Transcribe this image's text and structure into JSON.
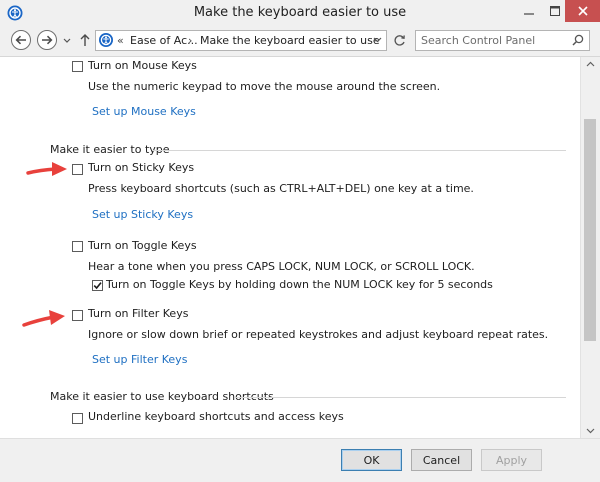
{
  "window": {
    "title": "Make the keyboard easier to use"
  },
  "nav": {
    "overflow": "«",
    "breadcrumb": [
      "Ease of Ac...",
      "Make the keyboard easier to use"
    ],
    "separator": "›",
    "search_placeholder": "Search Control Panel"
  },
  "mouse_keys": {
    "checkbox_label": "Turn on Mouse Keys",
    "description": "Use the numeric keypad to move the mouse around the screen.",
    "setup_link": "Set up Mouse Keys",
    "checked": false
  },
  "typing_group": {
    "header": "Make it easier to type",
    "sticky_keys": {
      "checkbox_label": "Turn on Sticky Keys",
      "description": "Press keyboard shortcuts (such as CTRL+ALT+DEL) one key at a time.",
      "setup_link": "Set up Sticky Keys",
      "checked": false
    },
    "toggle_keys": {
      "checkbox_label": "Turn on Toggle Keys",
      "description": "Hear a tone when you press CAPS LOCK, NUM LOCK, or SCROLL LOCK.",
      "sub_option_label": "Turn on Toggle Keys by holding down the NUM LOCK key for 5 seconds",
      "checked": false,
      "sub_option_checked": true
    },
    "filter_keys": {
      "checkbox_label": "Turn on Filter Keys",
      "description": "Ignore or slow down brief or repeated keystrokes and adjust keyboard repeat rates.",
      "setup_link": "Set up Filter Keys",
      "checked": false
    }
  },
  "shortcuts_group": {
    "header": "Make it easier to use keyboard shortcuts",
    "underline": {
      "checkbox_label": "Underline keyboard shortcuts and access keys",
      "checked": false
    }
  },
  "footer": {
    "ok": "OK",
    "cancel": "Cancel",
    "apply": "Apply"
  },
  "colors": {
    "link": "#1e6fc2",
    "annotation_arrow": "#e8413c",
    "close_button": "#c75050"
  },
  "icons": {
    "app": "ease-of-access-icon",
    "back": "arrow-left-icon",
    "forward": "arrow-right-icon",
    "recent": "chevron-down-icon",
    "up": "arrow-up-icon",
    "refresh": "refresh-icon",
    "search": "search-icon"
  }
}
